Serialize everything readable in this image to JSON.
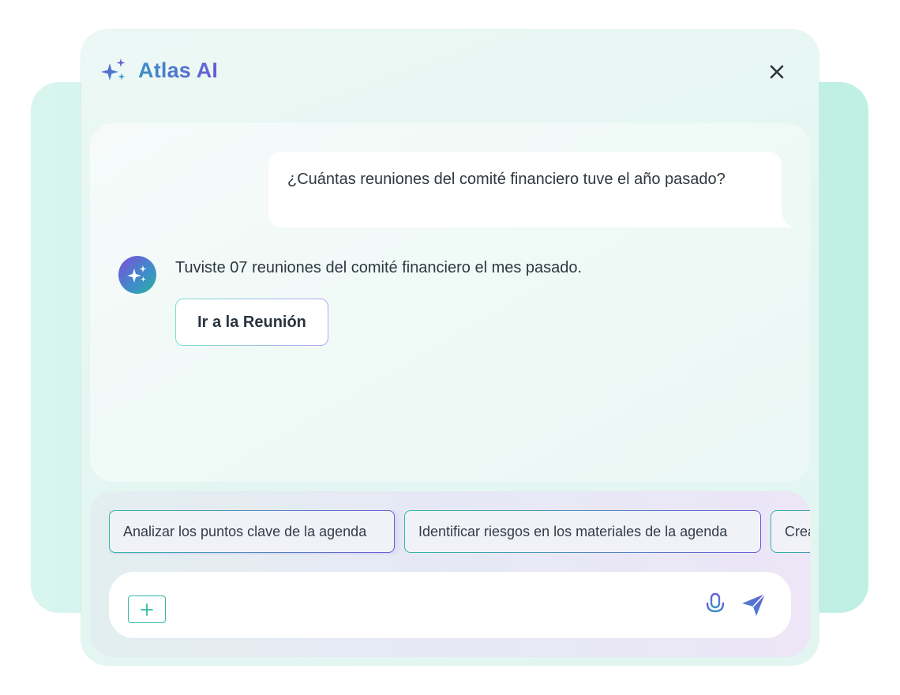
{
  "app": {
    "title": "Atlas AI"
  },
  "conversation": {
    "user_message": "¿Cuántas reuniones del comité financiero tuve el año pasado?",
    "ai_response": "Tuviste 07 reuniones del comité financiero el mes pasado.",
    "action_label": "Ir a la Reunión"
  },
  "suggestions": [
    {
      "label": "Analizar los puntos clave de la agenda"
    },
    {
      "label": "Identificar riesgos en los materiales de la agenda"
    },
    {
      "label": "Crea"
    }
  ],
  "composer": {
    "value": "",
    "placeholder": ""
  },
  "icons": {
    "logo": "sparkles-icon",
    "close": "close-icon",
    "avatar": "sparkles-icon",
    "attach": "plus-icon",
    "mic": "microphone-icon",
    "send": "send-icon"
  },
  "colors": {
    "brand_gradient_start": "#3a8fc8",
    "brand_gradient_end": "#6a5bd6",
    "teal_accent": "#2fb9a2"
  }
}
